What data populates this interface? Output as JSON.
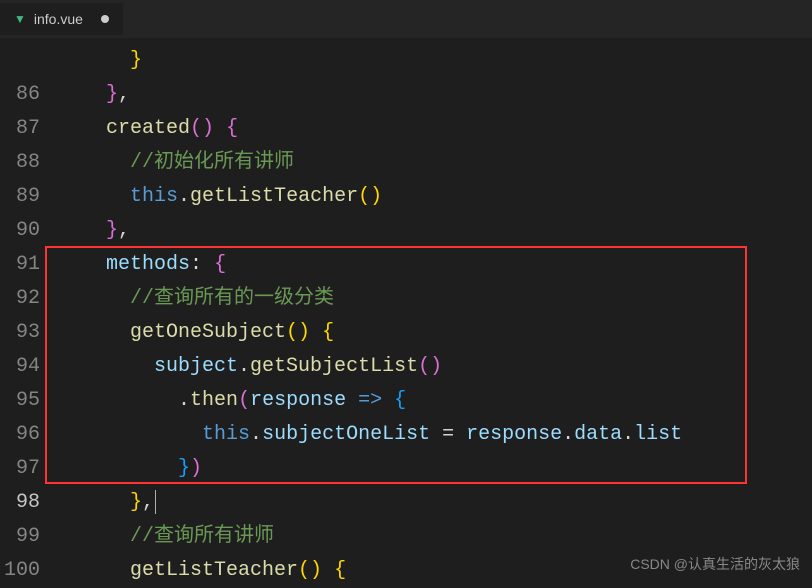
{
  "tab": {
    "filename": "info.vue",
    "modified": true
  },
  "line_numbers": [
    "",
    "86",
    "87",
    "88",
    "89",
    "90",
    "91",
    "92",
    "93",
    "94",
    "95",
    "96",
    "97",
    "98",
    "99",
    "100"
  ],
  "active_line_index": 13,
  "code": {
    "l0": "      }",
    "l1_open": "    },",
    "l2_created": "created",
    "l2_parens": "() {",
    "l3_comment": "//初始化所有讲师",
    "l4_this": "this",
    "l4_dot": ".",
    "l4_fn": "getListTeacher",
    "l4_call": "()",
    "l5": "    },",
    "l6_methods": "methods",
    "l6_colon": ": {",
    "l7_comment": "//查询所有的一级分类",
    "l8_fn": "getOneSubject",
    "l8_call": "() {",
    "l9_subject": "subject",
    "l9_dot": ".",
    "l9_fn": "getSubjectList",
    "l9_call": "()",
    "l10_dot": ".",
    "l10_then": "then",
    "l10_open": "(",
    "l10_resp": "response",
    "l10_arrow": " => ",
    "l10_brace": "{",
    "l11_this": "this",
    "l11_dot1": ".",
    "l11_prop": "subjectOneList",
    "l11_eq": " = ",
    "l11_resp": "response",
    "l11_dot2": ".",
    "l11_data": "data",
    "l11_dot3": ".",
    "l11_list": "list",
    "l12": "        })",
    "l13": "    },",
    "l14_comment": "//查询所有讲师",
    "l15_fn": "getListTeacher",
    "l15_call": "() {"
  },
  "watermark": "CSDN @认真生活的灰太狼"
}
